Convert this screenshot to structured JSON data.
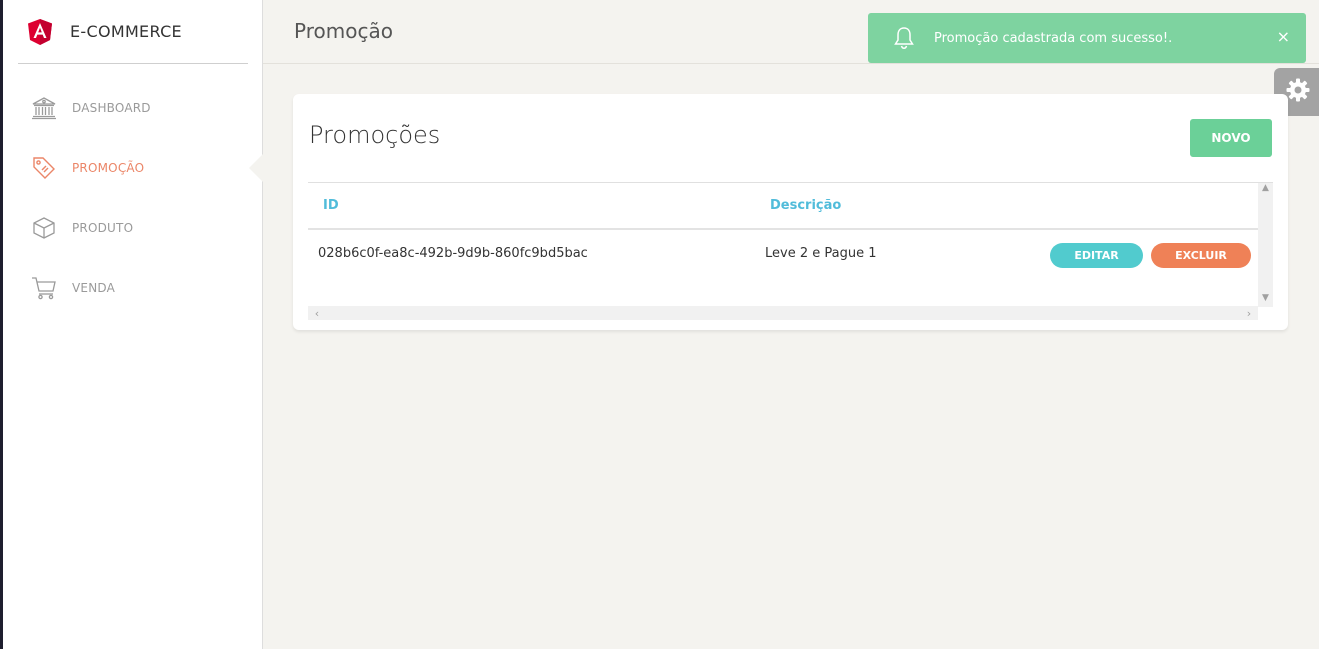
{
  "brand": {
    "name": "E-COMMERCE"
  },
  "sidebar": {
    "items": [
      {
        "label": "DASHBOARD",
        "icon": "bank-icon",
        "active": false
      },
      {
        "label": "PROMOÇÃO",
        "icon": "tag-icon",
        "active": true
      },
      {
        "label": "PRODUTO",
        "icon": "box-icon",
        "active": false
      },
      {
        "label": "VENDA",
        "icon": "cart-icon",
        "active": false
      }
    ]
  },
  "header": {
    "title": "Promoção"
  },
  "notification": {
    "message": "Promoção cadastrada com sucesso!.",
    "close": "×",
    "color": "#7ed3a0"
  },
  "card": {
    "title": "Promoções",
    "new_button": "NOVO",
    "table": {
      "columns": [
        "ID",
        "Descrição"
      ],
      "rows": [
        {
          "id": "028b6c0f-ea8c-492b-9d9b-860fc9bd5bac",
          "descricao": "Leve 2 e Pague 1",
          "edit": "EDITAR",
          "delete": "EXCLUIR"
        }
      ]
    }
  },
  "colors": {
    "accent_active": "#eb8668",
    "info": "#51cbce",
    "danger": "#ef8157",
    "success": "#6bd098"
  }
}
